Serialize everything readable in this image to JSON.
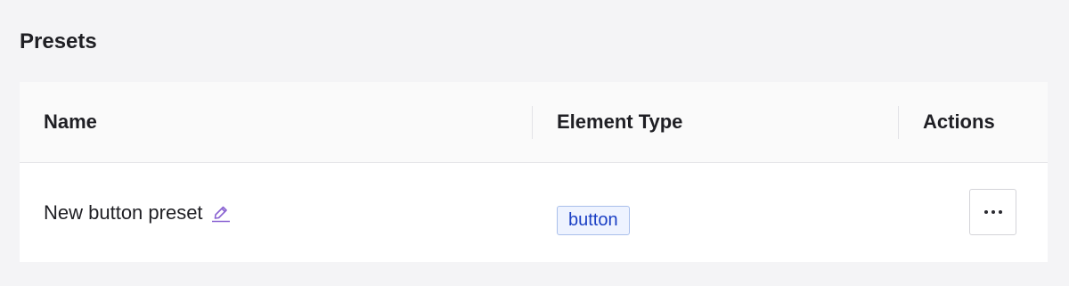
{
  "page": {
    "title": "Presets"
  },
  "table": {
    "columns": [
      {
        "label": "Name"
      },
      {
        "label": "Element Type"
      },
      {
        "label": "Actions"
      }
    ],
    "rows": [
      {
        "name": "New button preset",
        "element_type": "button",
        "edit_icon": "pencil-edit-icon",
        "actions_icon": "more-horizontal-icon"
      }
    ]
  },
  "colors": {
    "accent_edit_icon": "#8a63d2",
    "badge_text": "#1a3fc4",
    "badge_background": "#eef3ff",
    "badge_border": "#a9bfeb",
    "page_background": "#f4f4f6",
    "header_background": "#fafafa"
  }
}
